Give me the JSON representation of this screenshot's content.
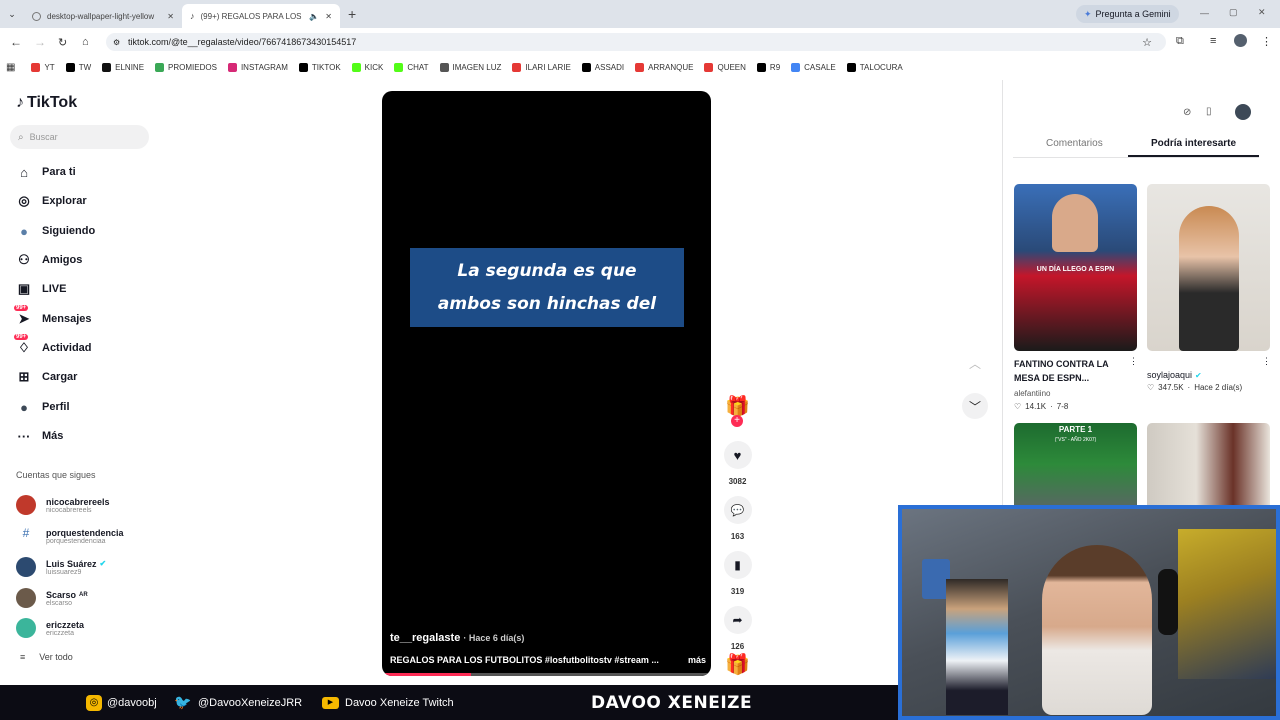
{
  "browser": {
    "tabs": [
      {
        "title": "desktop-wallpaper-light-yellow",
        "active": false
      },
      {
        "title": "(99+) REGALOS PARA LOS F",
        "active": true
      }
    ],
    "gemini_label": "Pregunta a Gemini",
    "url": "tiktok.com/@te__regalaste/video/7667418673430154517",
    "bookmarks": [
      "YT",
      "TW",
      "ELNINE",
      "PROMIEDOS",
      "INSTAGRAM",
      "TIKTOK",
      "KICK",
      "CHAT",
      "IMAGEN LUZ",
      "ILARI LARIE",
      "ASSADI",
      "ARRANQUE",
      "QUEEN",
      "R9",
      "CASALE",
      "TALOCURA"
    ]
  },
  "sidebar": {
    "logo": "TikTok",
    "search_placeholder": "Buscar",
    "nav": [
      {
        "label": "Para ti",
        "icon": "home-icon"
      },
      {
        "label": "Explorar",
        "icon": "compass-icon"
      },
      {
        "label": "Siguiendo",
        "icon": "following-avatar-icon"
      },
      {
        "label": "Amigos",
        "icon": "friends-icon"
      },
      {
        "label": "LIVE",
        "icon": "live-icon"
      },
      {
        "label": "Mensajes",
        "icon": "messages-icon",
        "badge": "99+"
      },
      {
        "label": "Actividad",
        "icon": "activity-icon",
        "badge": "99+"
      },
      {
        "label": "Cargar",
        "icon": "upload-icon"
      },
      {
        "label": "Perfil",
        "icon": "profile-avatar-icon"
      },
      {
        "label": "Más",
        "icon": "more-icon"
      }
    ],
    "following_title": "Cuentas que sigues",
    "following": [
      {
        "name": "nicocabrereels",
        "handle": "nicocabrereels",
        "verified": false,
        "color": "#c0392b"
      },
      {
        "name": "porquestendencia",
        "handle": "porquestendenciaa",
        "verified": false,
        "color": "#3a6fb0"
      },
      {
        "name": "Luis Suárez",
        "handle": "luissuarez9",
        "verified": true,
        "color": "#2c4a70"
      },
      {
        "name": "Scarso",
        "handle": "elscarso",
        "verified": false,
        "suffix": "AR",
        "color": "#6b5a4a"
      },
      {
        "name": "ericzzeta",
        "handle": "ericzzeta",
        "verified": false,
        "color": "#3bb59b"
      }
    ],
    "see_all": "Ver todo"
  },
  "video": {
    "caption_line1": "La segunda es que",
    "caption_line2": "ambos son hinchas del",
    "author": "te__regalaste",
    "posted": "· Hace 6 día(s)",
    "description": "REGALOS PARA LOS FUTBOLITOS #losfutbolitostv #stream ...",
    "more": "más",
    "progress": 0.27
  },
  "actions": {
    "likes": "3082",
    "comments": "163",
    "saves": "319",
    "shares": "126"
  },
  "right_panel": {
    "tabs": [
      "Comentarios",
      "Podría interesarte"
    ],
    "active_tab": 1,
    "cards": [
      {
        "title": "FANTINO CONTRA LA MESA DE ESPN...",
        "author": "alefantiino",
        "likes": "14.1K",
        "date": "7-8",
        "overlay": "UN DÍA LLEGO A ESPN"
      },
      {
        "title": "",
        "author": "soylajoaqui",
        "verified": true,
        "likes": "347.5K",
        "date": "Hace 2 día(s)"
      },
      {
        "overlay": "PARTE 1",
        "sub": "(\"VS\" - AÑO 2K07)"
      },
      {}
    ]
  },
  "stream_bar": {
    "instagram": "@davoobj",
    "twitter": "@DavooXeneizeJRR",
    "youtube": "Davoo Xeneize Twitch",
    "brand": "DAVOO XENEIZE"
  },
  "colors": {
    "tiktok_red": "#fe2c55",
    "caption_bg": "#1d4c87",
    "cam_border": "#2a6fd6"
  }
}
